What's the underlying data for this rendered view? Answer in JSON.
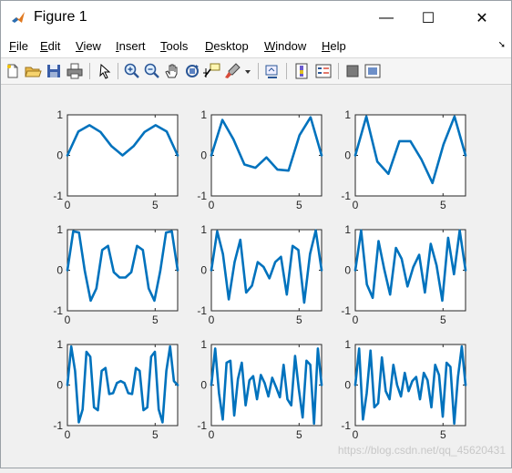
{
  "window": {
    "title": "Figure 1",
    "minimize_glyph": "—",
    "maximize_glyph": "☐",
    "close_glyph": "✕"
  },
  "menus": [
    "File",
    "Edit",
    "View",
    "Insert",
    "Tools",
    "Desktop",
    "Window",
    "Help"
  ],
  "menu_underline": [
    "F",
    "E",
    "V",
    "I",
    "T",
    "D",
    "W",
    "H"
  ],
  "toolbar_icons": [
    "new-figure-icon",
    "open-file-icon",
    "save-icon",
    "print-icon",
    "edit-plot-arrow-icon",
    "zoom-in-icon",
    "zoom-out-icon",
    "pan-hand-icon",
    "rotate-3d-icon",
    "data-cursor-icon",
    "brush-icon",
    "brush-dropdown-icon",
    "link-plot-icon",
    "insert-colorbar-icon",
    "insert-legend-icon",
    "hide-plot-tools-icon",
    "show-plot-tools-icon"
  ],
  "colors": {
    "line": "#0072BD",
    "axes_bg": "#ffffff",
    "figure_bg": "#f0f0f0"
  },
  "watermark": "https://blog.csdn.net/qq_45620431",
  "chart_data": [
    {
      "type": "line",
      "title": "",
      "xlabel": "",
      "ylabel": "",
      "xlim": [
        0,
        6.2832
      ],
      "ylim": [
        -1,
        1
      ],
      "xticks": [
        "0",
        "5"
      ],
      "yticks": [
        "1",
        "0",
        "-1"
      ],
      "x": [
        0,
        0.6283,
        1.2566,
        1.885,
        2.5133,
        3.1416,
        3.7699,
        4.3982,
        5.0265,
        5.6549,
        6.2832
      ],
      "series": [
        {
          "values": [
            0,
            0.59,
            0.744,
            0.578,
            0.226,
            0,
            0.226,
            0.578,
            0.744,
            0.59,
            0
          ]
        }
      ]
    },
    {
      "type": "line",
      "title": "",
      "xlabel": "",
      "ylabel": "",
      "xlim": [
        0,
        6.2832
      ],
      "ylim": [
        -1,
        1
      ],
      "xticks": [
        "0",
        "5"
      ],
      "yticks": [
        "1",
        "0",
        "-1"
      ],
      "x": [
        0,
        0.6283,
        1.2566,
        1.885,
        2.5133,
        3.1416,
        3.7699,
        4.3982,
        5.0265,
        5.6549,
        6.2832
      ],
      "series": [
        {
          "values": [
            0,
            0.874,
            0.397,
            -0.225,
            -0.306,
            -0.05,
            -0.35,
            -0.375,
            0.5,
            0.94,
            0
          ]
        }
      ]
    },
    {
      "type": "line",
      "title": "",
      "xlabel": "",
      "ylabel": "",
      "xlim": [
        0,
        6.2832
      ],
      "ylim": [
        -1,
        1
      ],
      "xticks": [
        "0",
        "5"
      ],
      "yticks": [
        "1",
        "0",
        "-1"
      ],
      "x": [
        0,
        0.6283,
        1.2566,
        1.885,
        2.5133,
        3.1416,
        3.7699,
        4.3982,
        5.0265,
        5.6549,
        6.2832
      ],
      "series": [
        {
          "values": [
            0,
            0.96,
            -0.154,
            -0.456,
            0.35,
            0.35,
            -0.1,
            -0.68,
            0.27,
            0.96,
            0
          ]
        }
      ]
    },
    {
      "type": "line",
      "title": "",
      "xlabel": "",
      "ylabel": "",
      "xlim": [
        0,
        6.2832
      ],
      "ylim": [
        -1,
        1
      ],
      "xticks": [
        "0",
        "5"
      ],
      "yticks": [
        "1",
        "0",
        "-1"
      ],
      "x": [
        0,
        0.3307,
        0.6614,
        0.9921,
        1.3228,
        1.6535,
        1.9842,
        2.3149,
        2.6456,
        2.9762,
        3.3069,
        3.6376,
        3.9683,
        4.299,
        4.6297,
        4.9604,
        5.2911,
        5.6218,
        5.9525,
        6.2832
      ],
      "series": [
        {
          "values": [
            0,
            0.96,
            0.93,
            -0.02,
            -0.75,
            -0.45,
            0.5,
            0.6,
            -0.05,
            -0.18,
            -0.18,
            -0.05,
            0.6,
            0.5,
            -0.45,
            -0.75,
            -0.02,
            0.93,
            0.96,
            0
          ]
        }
      ]
    },
    {
      "type": "line",
      "title": "",
      "xlabel": "",
      "ylabel": "",
      "xlim": [
        0,
        6.2832
      ],
      "ylim": [
        -1,
        1
      ],
      "xticks": [
        "0",
        "5"
      ],
      "yticks": [
        "1",
        "0",
        "-1"
      ],
      "x": [
        0,
        0.3307,
        0.6614,
        0.9921,
        1.3228,
        1.6535,
        1.9842,
        2.3149,
        2.6456,
        2.9762,
        3.3069,
        3.6376,
        3.9683,
        4.299,
        4.6297,
        4.9604,
        5.2911,
        5.6218,
        5.9525,
        6.2832
      ],
      "series": [
        {
          "values": [
            0,
            0.96,
            0.4,
            -0.72,
            0.2,
            0.75,
            -0.55,
            -0.38,
            0.2,
            0.08,
            -0.2,
            0.2,
            0.33,
            -0.6,
            0.6,
            0.5,
            -0.8,
            0.4,
            0.98,
            0
          ]
        }
      ]
    },
    {
      "type": "line",
      "title": "",
      "xlabel": "",
      "ylabel": "",
      "xlim": [
        0,
        6.2832
      ],
      "ylim": [
        -1,
        1
      ],
      "xticks": [
        "0",
        "5"
      ],
      "yticks": [
        "1",
        "0",
        "-1"
      ],
      "x": [
        0,
        0.3307,
        0.6614,
        0.9921,
        1.3228,
        1.6535,
        1.9842,
        2.3149,
        2.6456,
        2.9762,
        3.3069,
        3.6376,
        3.9683,
        4.299,
        4.6297,
        4.9604,
        5.2911,
        5.6218,
        5.9525,
        6.2832
      ],
      "series": [
        {
          "values": [
            0,
            0.98,
            -0.35,
            -0.68,
            0.72,
            0.02,
            -0.6,
            0.55,
            0.28,
            -0.4,
            0.08,
            0.38,
            -0.55,
            0.65,
            0.12,
            -0.75,
            0.8,
            -0.1,
            0.98,
            0
          ]
        }
      ]
    },
    {
      "type": "line",
      "title": "",
      "xlabel": "",
      "ylabel": "",
      "xlim": [
        0,
        6.2832
      ],
      "ylim": [
        -1,
        1
      ],
      "xticks": [
        "0",
        "5"
      ],
      "yticks": [
        "1",
        "0",
        "-1"
      ],
      "x": [
        0,
        0.2168,
        0.4336,
        0.6504,
        0.8672,
        1.084,
        1.3008,
        1.5176,
        1.7344,
        1.9512,
        2.168,
        2.3848,
        2.6016,
        2.8184,
        3.0352,
        3.252,
        3.4688,
        3.6856,
        3.9024,
        4.1192,
        4.336,
        4.5528,
        4.7696,
        4.9864,
        5.2032,
        5.42,
        5.6368,
        5.8536,
        6.0704,
        6.2832
      ],
      "series": [
        {
          "values": [
            0,
            0.95,
            0.35,
            -0.92,
            -0.6,
            0.82,
            0.7,
            -0.55,
            -0.62,
            0.35,
            0.42,
            -0.22,
            -0.2,
            0.05,
            0.1,
            0.05,
            -0.2,
            -0.22,
            0.42,
            0.35,
            -0.62,
            -0.55,
            0.7,
            0.82,
            -0.6,
            -0.92,
            0.35,
            0.95,
            0.1,
            0
          ]
        }
      ]
    },
    {
      "type": "line",
      "title": "",
      "xlabel": "",
      "ylabel": "",
      "xlim": [
        0,
        6.2832
      ],
      "ylim": [
        -1,
        1
      ],
      "xticks": [
        "0",
        "5"
      ],
      "yticks": [
        "1",
        "0",
        "-1"
      ],
      "x": [
        0,
        0.2168,
        0.4336,
        0.6504,
        0.8672,
        1.084,
        1.3008,
        1.5176,
        1.7344,
        1.9512,
        2.168,
        2.3848,
        2.6016,
        2.8184,
        3.0352,
        3.252,
        3.4688,
        3.6856,
        3.9024,
        4.1192,
        4.336,
        4.5528,
        4.7696,
        4.9864,
        5.2032,
        5.42,
        5.6368,
        5.8536,
        6.0704,
        6.2832
      ],
      "series": [
        {
          "values": [
            0,
            0.9,
            -0.2,
            -0.85,
            0.55,
            0.6,
            -0.75,
            0.15,
            0.55,
            -0.5,
            0.12,
            0.22,
            -0.35,
            0.25,
            0.05,
            -0.28,
            0.18,
            -0.05,
            -0.3,
            0.5,
            -0.35,
            -0.5,
            0.72,
            -0.1,
            -0.8,
            0.6,
            0.5,
            -0.95,
            0.9,
            0
          ]
        }
      ]
    },
    {
      "type": "line",
      "title": "",
      "xlabel": "",
      "ylabel": "",
      "xlim": [
        0,
        6.2832
      ],
      "ylim": [
        -1,
        1
      ],
      "xticks": [
        "0",
        "5"
      ],
      "yticks": [
        "1",
        "0",
        "-1"
      ],
      "x": [
        0,
        0.2168,
        0.4336,
        0.6504,
        0.8672,
        1.084,
        1.3008,
        1.5176,
        1.7344,
        1.9512,
        2.168,
        2.3848,
        2.6016,
        2.8184,
        3.0352,
        3.252,
        3.4688,
        3.6856,
        3.9024,
        4.1192,
        4.336,
        4.5528,
        4.7696,
        4.9864,
        5.2032,
        5.42,
        5.6368,
        5.8536,
        6.0704,
        6.2832
      ],
      "series": [
        {
          "values": [
            0,
            0.9,
            -0.85,
            -0.2,
            0.85,
            -0.55,
            -0.45,
            0.68,
            -0.15,
            -0.35,
            0.5,
            0,
            -0.28,
            0.3,
            -0.15,
            0.1,
            0.2,
            -0.35,
            0.3,
            0.12,
            -0.55,
            0.5,
            0.25,
            -0.78,
            0.55,
            0.45,
            -0.95,
            0.2,
            0.95,
            0
          ]
        }
      ]
    }
  ]
}
